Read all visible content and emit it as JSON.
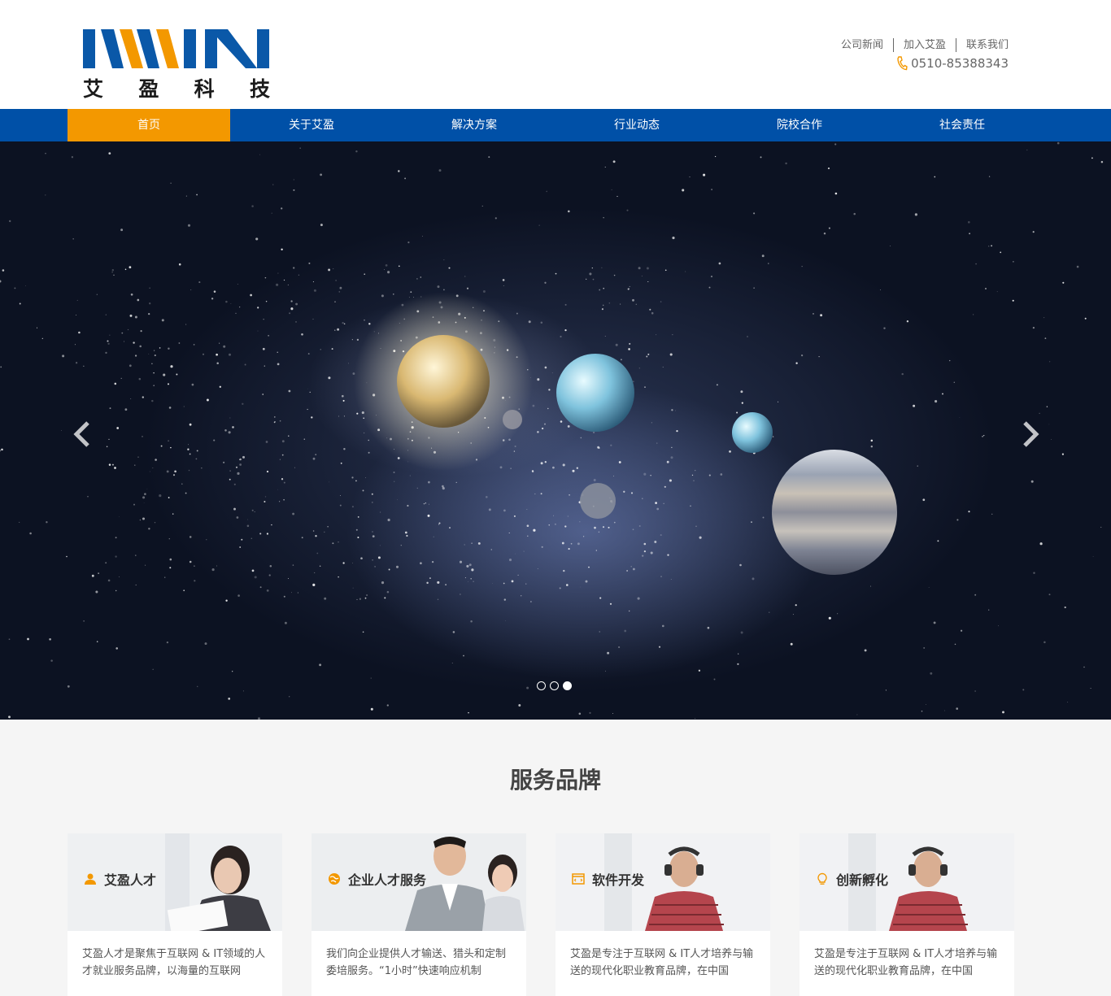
{
  "logo": {
    "mark": "IWIN",
    "name_cn": [
      "艾",
      "盈",
      "科",
      "技"
    ]
  },
  "top_links": [
    "公司新闻",
    "加入艾盈",
    "联系我们"
  ],
  "phone": {
    "icon": "phone-icon",
    "number": "0510-85388343"
  },
  "nav": {
    "items": [
      "首页",
      "关于艾盈",
      "解决方案",
      "行业动态",
      "院校合作",
      "社会责任"
    ],
    "active_index": 0
  },
  "carousel": {
    "slide_count": 3,
    "active_slide": 3
  },
  "services": {
    "title": "服务品牌",
    "cards": [
      {
        "icon": "person-icon",
        "title": "艾盈人才",
        "text": "艾盈人才是聚焦于互联网 & IT领域的人才就业服务品牌，以海量的互联网"
      },
      {
        "icon": "globe-icon",
        "title": "企业人才服务",
        "text": "我们向企业提供人才输送、猎头和定制委培服务。“1小时”快速响应机制"
      },
      {
        "icon": "code-window-icon",
        "title": "软件开发",
        "text": "艾盈是专注于互联网 & IT人才培养与输送的现代化职业教育品牌，在中国"
      },
      {
        "icon": "lightbulb-icon",
        "title": "创新孵化",
        "text": "艾盈是专注于互联网 & IT人才培养与输送的现代化职业教育品牌，在中国"
      }
    ]
  },
  "colors": {
    "brand_blue": "#0050a7",
    "accent_orange": "#f39800"
  }
}
